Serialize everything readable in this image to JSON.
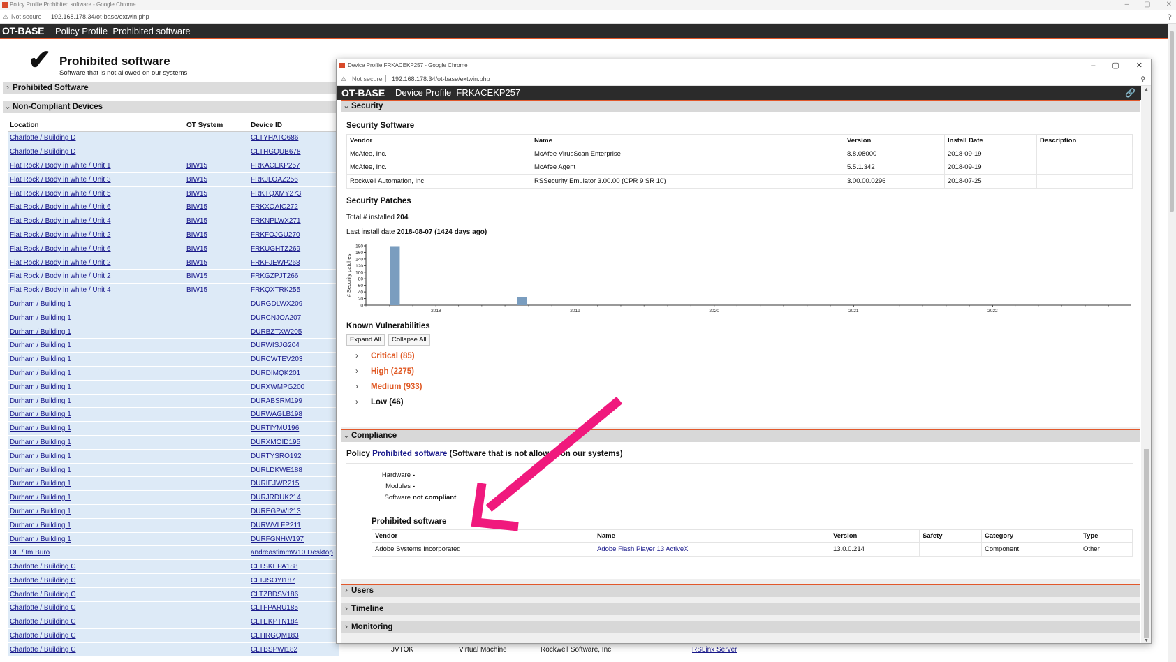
{
  "outer": {
    "window_title": "Policy Profile Prohibited software - Google Chrome",
    "not_secure": "Not secure",
    "url": "192.168.178.34/ot-base/extwin.php",
    "logo": "OT-BASE",
    "breadcrumb": "Policy Profile  Prohibited software",
    "page_title": "Prohibited software",
    "page_subtitle": "Software that is not allowed on our systems",
    "section_prohibited": "Prohibited Software",
    "section_noncompliant": "Non-Compliant Devices",
    "columns": [
      "Location",
      "OT System",
      "Device ID"
    ],
    "rows": [
      [
        "Charlotte / Building D",
        "",
        "CLTYHATO686"
      ],
      [
        "Charlotte / Building D",
        "",
        "CLTHGQUB678"
      ],
      [
        "Flat Rock / Body in white / Unit 1",
        "BIW15",
        "FRKACEKP257"
      ],
      [
        "Flat Rock / Body in white / Unit 3",
        "BIW15",
        "FRKJLOAZ256"
      ],
      [
        "Flat Rock / Body in white / Unit 5",
        "BIW15",
        "FRKTQXMY273"
      ],
      [
        "Flat Rock / Body in white / Unit 6",
        "BIW15",
        "FRKXQAIC272"
      ],
      [
        "Flat Rock / Body in white / Unit 4",
        "BIW15",
        "FRKNPLWX271"
      ],
      [
        "Flat Rock / Body in white / Unit 2",
        "BIW15",
        "FRKFOJGU270"
      ],
      [
        "Flat Rock / Body in white / Unit 6",
        "BIW15",
        "FRKUGHTZ269"
      ],
      [
        "Flat Rock / Body in white / Unit 2",
        "BIW15",
        "FRKFJEWP268"
      ],
      [
        "Flat Rock / Body in white / Unit 2",
        "BIW15",
        "FRKGZPJT266"
      ],
      [
        "Flat Rock / Body in white / Unit 4",
        "BIW15",
        "FRKQXTRK255"
      ],
      [
        "Durham / Building 1",
        "",
        "DURGDLWX209"
      ],
      [
        "Durham / Building 1",
        "",
        "DURCNJOA207"
      ],
      [
        "Durham / Building 1",
        "",
        "DURBZTXW205"
      ],
      [
        "Durham / Building 1",
        "",
        "DURWISJG204"
      ],
      [
        "Durham / Building 1",
        "",
        "DURCWTEV203"
      ],
      [
        "Durham / Building 1",
        "",
        "DURDIMQK201"
      ],
      [
        "Durham / Building 1",
        "",
        "DURXWMPG200"
      ],
      [
        "Durham / Building 1",
        "",
        "DURABSRM199"
      ],
      [
        "Durham / Building 1",
        "",
        "DURWAGLB198"
      ],
      [
        "Durham / Building 1",
        "",
        "DURTIYMU196"
      ],
      [
        "Durham / Building 1",
        "",
        "DURXMOID195"
      ],
      [
        "Durham / Building 1",
        "",
        "DURTYSRO192"
      ],
      [
        "Durham / Building 1",
        "",
        "DURLDKWE188"
      ],
      [
        "Durham / Building 1",
        "",
        "DURIEJWR215"
      ],
      [
        "Durham / Building 1",
        "",
        "DURJRDUK214"
      ],
      [
        "Durham / Building 1",
        "",
        "DUREGPWI213"
      ],
      [
        "Durham / Building 1",
        "",
        "DURWVLFP211"
      ],
      [
        "Durham / Building 1",
        "",
        "DURFGNHW197"
      ],
      [
        "DE / Im Büro",
        "",
        "andreastimmW10 Desktop"
      ],
      [
        "Charlotte / Building C",
        "",
        "CLTSKEPA188"
      ],
      [
        "Charlotte / Building C",
        "",
        "CLTJSOYI187"
      ],
      [
        "Charlotte / Building C",
        "",
        "CLTZBDSV186"
      ],
      [
        "Charlotte / Building C",
        "",
        "CLTFPARU185"
      ],
      [
        "Charlotte / Building C",
        "",
        "CLTEKPTN184"
      ],
      [
        "Charlotte / Building C",
        "",
        "CLTIRGQM183"
      ],
      [
        "Charlotte / Building C",
        "",
        "CLTBSPWI182"
      ]
    ],
    "last_row_extra": {
      "ot_system": "JVTOK",
      "type": "Virtual Machine",
      "vendor": "Rockwell Software, Inc.",
      "software": "RSLinx Server"
    }
  },
  "popup": {
    "window_title": "Device Profile FRKACEKP257 - Google Chrome",
    "not_secure": "Not secure",
    "url": "192.168.178.34/ot-base/extwin.php",
    "logo": "OT-BASE",
    "breadcrumb": "Device Profile  FRKACEKP257",
    "security": {
      "header": "Security",
      "software_title": "Security Software",
      "software_columns": [
        "Vendor",
        "Name",
        "Version",
        "Install Date",
        "Description"
      ],
      "software_rows": [
        [
          "McAfee, Inc.",
          "McAfee VirusScan Enterprise",
          "8.8.08000",
          "2018-09-19",
          ""
        ],
        [
          "McAfee, Inc.",
          "McAfee Agent",
          "5.5.1.342",
          "2018-09-19",
          ""
        ],
        [
          "Rockwell Automation, Inc.",
          "RSSecurity Emulator 3.00.00 (CPR 9 SR 10)",
          "3.00.00.0296",
          "2018-07-25",
          ""
        ]
      ],
      "patches_title": "Security Patches",
      "total_label": "Total # installed",
      "total_value": "204",
      "last_label": "Last install date",
      "last_value": "2018-08-07 (1424 days ago)",
      "vuln_title": "Known Vulnerabilities",
      "expand_all": "Expand All",
      "collapse_all": "Collapse All",
      "vulns": [
        {
          "label": "Critical (85)",
          "color": "#e05a25"
        },
        {
          "label": "High (2275)",
          "color": "#e05a25"
        },
        {
          "label": "Medium (933)",
          "color": "#e05a25"
        },
        {
          "label": "Low (46)",
          "color": "#111111"
        }
      ]
    },
    "compliance": {
      "header": "Compliance",
      "policy_prefix": "Policy",
      "policy_link": "Prohibited software",
      "policy_suffix": "(Software that is not allowed on our systems)",
      "hardware_label": "Hardware",
      "hardware_value": "-",
      "modules_label": "Modules",
      "modules_value": "-",
      "software_label": "Software",
      "software_value": "not compliant",
      "prohibited_title": "Prohibited software",
      "columns": [
        "Vendor",
        "Name",
        "Version",
        "Safety",
        "Category",
        "Type"
      ],
      "rows": [
        [
          "Adobe Systems Incorporated",
          "Adobe Flash Player 13 ActiveX",
          "13.0.0.214",
          "",
          "Component",
          "Other"
        ]
      ]
    },
    "sections_collapsed": [
      "Users",
      "Timeline",
      "Monitoring"
    ]
  },
  "chart_data": {
    "type": "bar",
    "ylabel": "# Security patches",
    "xlabel": "",
    "yticks": [
      0,
      20,
      40,
      60,
      80,
      100,
      120,
      140,
      160,
      180
    ],
    "ylim": [
      0,
      180
    ],
    "xticks": [
      "2018",
      "2019",
      "2020",
      "2021",
      "2022"
    ],
    "x": [
      "2017-09",
      "2018-08"
    ],
    "values": [
      179,
      25
    ],
    "bar_color": "#7a9dbf"
  },
  "annotation": {
    "arrow_color": "#f0197d"
  }
}
